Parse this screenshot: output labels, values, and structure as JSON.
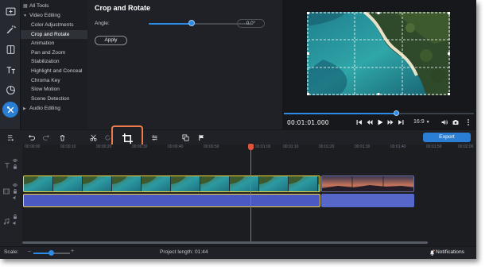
{
  "colors": {
    "accent": "#2a7fd4",
    "highlight": "#ee7c4a",
    "selection": "#f0d23c",
    "playhead": "#e0543e",
    "audio": "#4a5ac2"
  },
  "sidebar": {
    "icons": [
      "import-icon",
      "magic-wand-icon",
      "transitions-icon",
      "titles-icon",
      "stickers-icon",
      "more-tools-icon"
    ]
  },
  "tools": {
    "items": [
      {
        "label": "All Tools",
        "kind": "top"
      },
      {
        "label": "Video Editing",
        "kind": "top-expanded"
      },
      {
        "label": "Color Adjustments",
        "kind": "sub"
      },
      {
        "label": "Crop and Rotate",
        "kind": "sub",
        "selected": true
      },
      {
        "label": "Animation",
        "kind": "sub"
      },
      {
        "label": "Pan and Zoom",
        "kind": "sub"
      },
      {
        "label": "Stabilization",
        "kind": "sub"
      },
      {
        "label": "Highlight and Conceal",
        "kind": "sub"
      },
      {
        "label": "Chroma Key",
        "kind": "sub"
      },
      {
        "label": "Slow Motion",
        "kind": "sub"
      },
      {
        "label": "Scene Detection",
        "kind": "sub"
      },
      {
        "label": "Audio Editing",
        "kind": "top-collapsed"
      }
    ]
  },
  "panel": {
    "title": "Crop and Rotate",
    "angle_label": "Angle:",
    "angle_value": "0,0°",
    "angle_fraction": 0.45,
    "apply_label": "Apply"
  },
  "player": {
    "timecode": "00:01:01.000",
    "aspect": "16:9",
    "seek_fraction": 0.59
  },
  "toolbar": {
    "export_label": "Export"
  },
  "timeline": {
    "ruler": [
      "00:00:00",
      "00:00:10",
      "00:00:20",
      "00:00:30",
      "00:00:40",
      "00:00:50",
      "00:01:00",
      "00:01:10",
      "00:01:20",
      "00:01:30",
      "00:01:40",
      "00:01:50",
      "00:02:00",
      "00:02:10"
    ]
  },
  "status": {
    "scale_label": "Scale:",
    "project_length": "Project length: 01:44",
    "notifications": "Notifications"
  }
}
